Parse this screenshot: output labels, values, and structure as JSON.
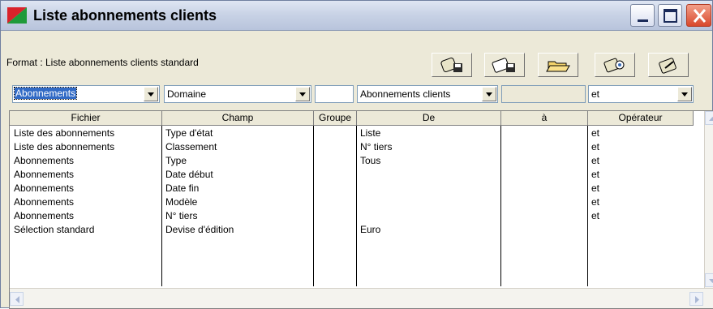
{
  "window": {
    "title": "Liste abonnements clients",
    "icon": "app-icon"
  },
  "format": {
    "label": "Format : Liste abonnements clients standard"
  },
  "toolbar": {
    "buttons": [
      {
        "name": "save-format-button",
        "icon": "disk-save-icon"
      },
      {
        "name": "save-as-format-button",
        "icon": "disk-save-as-icon"
      },
      {
        "name": "open-format-button",
        "icon": "folder-open-icon"
      },
      {
        "name": "preview-button",
        "icon": "preview-icon"
      },
      {
        "name": "edit-format-button",
        "icon": "edit-icon"
      }
    ]
  },
  "filters": {
    "fichier": "Abonnements",
    "champ": "Domaine",
    "groupe": "",
    "de": "Abonnements clients",
    "a": "",
    "operateur": "et"
  },
  "grid": {
    "headers": [
      "Fichier",
      "Champ",
      "Groupe",
      "De",
      "à",
      "Opérateur"
    ],
    "rows": [
      [
        "Liste des abonnements",
        "Type d'état",
        "",
        "Liste",
        "",
        "et"
      ],
      [
        "Liste des abonnements",
        "Classement",
        "",
        "N° tiers",
        "",
        "et"
      ],
      [
        "Abonnements",
        "Type",
        "",
        "Tous",
        "",
        "et"
      ],
      [
        "Abonnements",
        "Date début",
        "",
        "",
        "",
        "et"
      ],
      [
        "Abonnements",
        "Date fin",
        "",
        "",
        "",
        "et"
      ],
      [
        "Abonnements",
        "Modèle",
        "",
        "",
        "",
        "et"
      ],
      [
        "Abonnements",
        "N° tiers",
        "",
        "",
        "",
        "et"
      ],
      [
        "Sélection standard",
        "Devise d'édition",
        "",
        "Euro",
        "",
        ""
      ]
    ]
  },
  "colors": {
    "titlebar": "#c9d3e6",
    "window_bg": "#ece9d8",
    "selection": "#316ac5",
    "close_button": "#d9482c"
  }
}
